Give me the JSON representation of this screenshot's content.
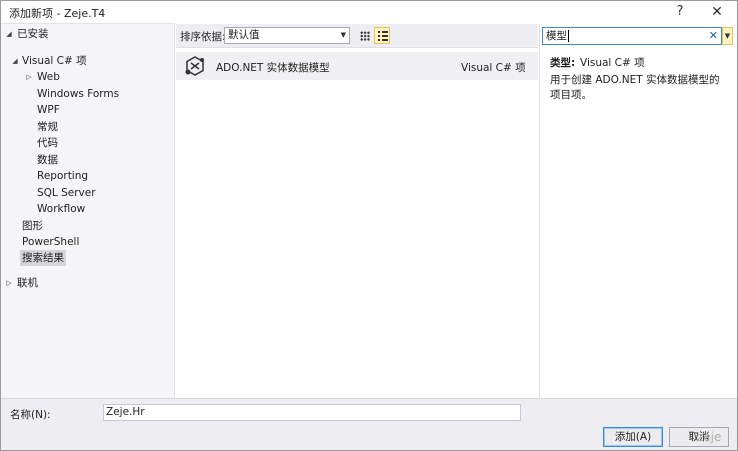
{
  "window": {
    "title": "添加新项 - Zeje.T4",
    "help_label": "?",
    "close_label": "✕"
  },
  "tree": {
    "installed": "已安装",
    "visual_csharp": "Visual C# 项",
    "web": "Web",
    "windows_forms": "Windows Forms",
    "wpf": "WPF",
    "general": "常规",
    "code": "代码",
    "data": "数据",
    "reporting": "Reporting",
    "sql_server": "SQL Server",
    "workflow": "Workflow",
    "graphics": "图形",
    "powershell": "PowerShell",
    "search_results": "搜索结果",
    "online": "联机"
  },
  "toolbar": {
    "sort_label": "排序依据:",
    "sort_value": "默认值"
  },
  "items": [
    {
      "name": "ADO.NET 实体数据模型",
      "type": "Visual C# 项"
    }
  ],
  "search": {
    "value": "模型",
    "clear_label": "✕"
  },
  "details": {
    "type_label": "类型:",
    "type_value": "Visual C# 项",
    "description": "用于创建 ADO.NET 实体数据模型的项目项。"
  },
  "footer": {
    "name_label": "名称(N):",
    "name_value": "Zeje.Hr",
    "add_label": "添加(A)",
    "cancel_label": "取消",
    "watermark": "zeje"
  }
}
